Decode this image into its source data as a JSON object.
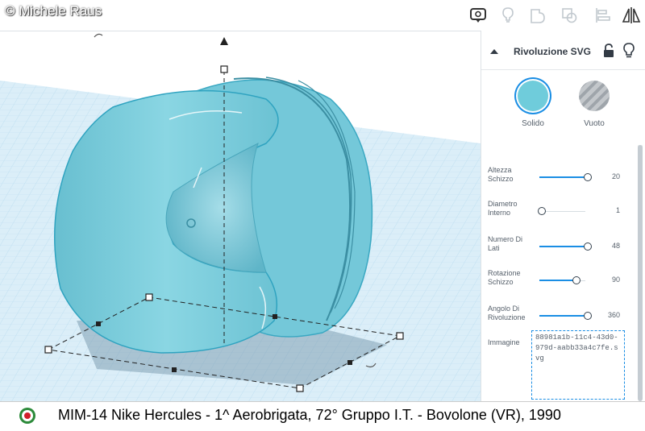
{
  "watermark": "© Michele Raus",
  "toolbar": {
    "icons": [
      "notes-view-icon",
      "lightbulb-icon",
      "group-icon",
      "ungroup-icon",
      "align-icon",
      "mirror-icon"
    ]
  },
  "panel": {
    "title": "Rivoluzione SVG",
    "modes": {
      "solid": "Solido",
      "hole": "Vuoto"
    },
    "params": [
      {
        "label": "Altezza Schizzo",
        "value": "20",
        "fraction": 0.95
      },
      {
        "label": "Diametro Interno",
        "value": "1",
        "fraction": 0.0
      },
      {
        "label": "Numero Di Lati",
        "value": "48",
        "fraction": 0.95
      },
      {
        "label": "Rotazione Schizzo",
        "value": "90",
        "fraction": 0.72
      },
      {
        "label": "Angolo Di Rivoluzione",
        "value": "360",
        "fraction": 0.95
      }
    ],
    "image_label": "Immagine",
    "image_value": "88981a1b-11c4-43d0-979d-aabb33a4c7fe.svg"
  },
  "colors": {
    "shape": "#7dcedc",
    "accent": "#1a8ee4",
    "grid": "#a9d3ec"
  },
  "caption": "MIM-14 Nike Hercules - 1^ Aerobrigata, 72° Gruppo I.T. - Bovolone (VR), 1990"
}
